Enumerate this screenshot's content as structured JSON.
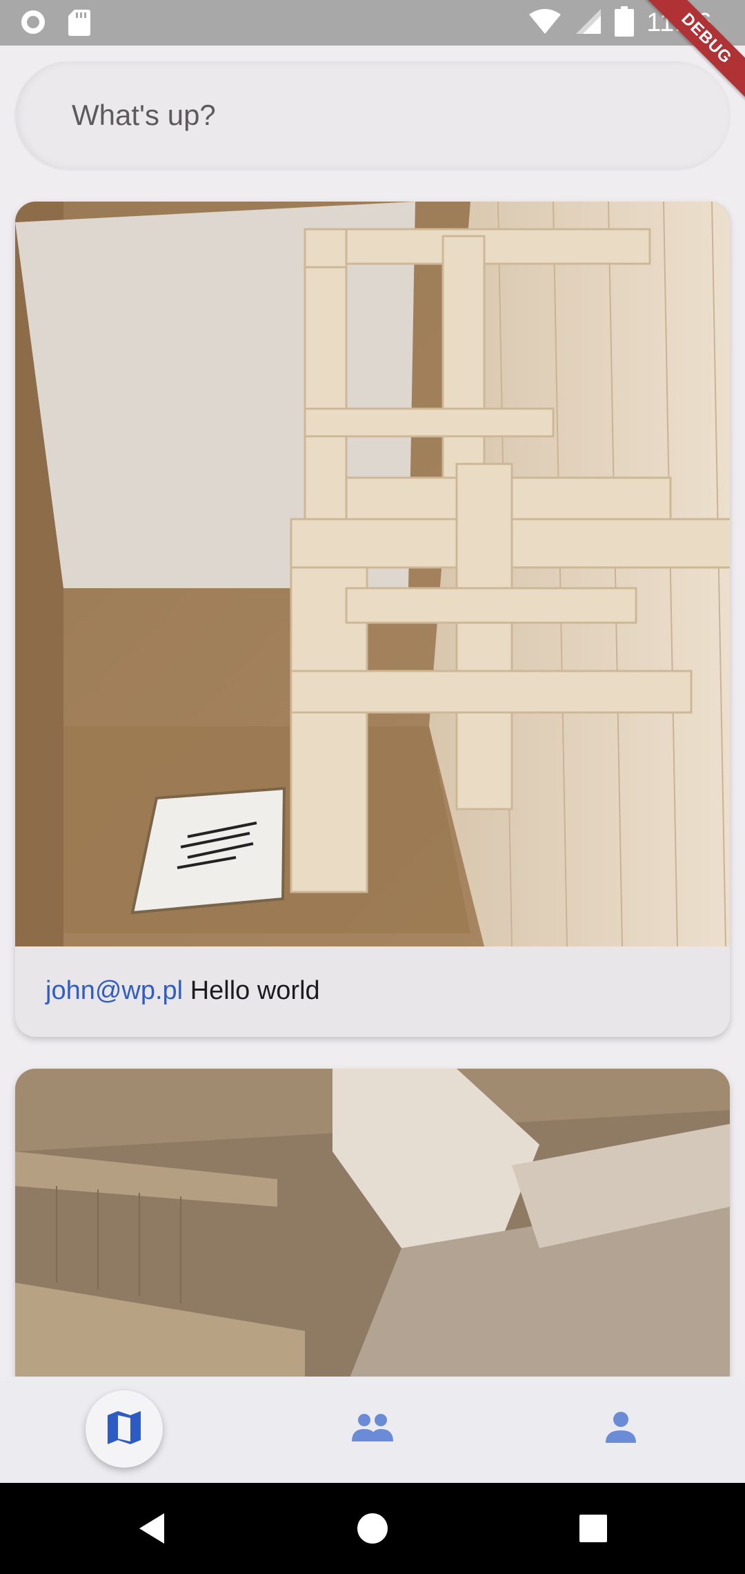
{
  "status_bar": {
    "time": "11:16",
    "icons": [
      "record-icon",
      "sd-card-icon",
      "wifi-icon",
      "signal-icon",
      "battery-icon"
    ]
  },
  "debug_banner": {
    "label": "DEBUG",
    "color": "#b13235"
  },
  "compose": {
    "placeholder": "What's up?"
  },
  "posts": [
    {
      "user": "john@wp.pl",
      "text": "Hello world",
      "image": "room-interior-render"
    },
    {
      "user": "",
      "text": "",
      "image": "room-interior-render"
    }
  ],
  "bottom_nav": {
    "items": [
      {
        "icon": "map-icon",
        "active": true
      },
      {
        "icon": "people-icon",
        "active": false
      },
      {
        "icon": "person-icon",
        "active": false
      }
    ],
    "accent_color": "#2d5bc4"
  },
  "system_nav": {
    "buttons": [
      "back-icon",
      "home-icon",
      "recents-icon"
    ]
  }
}
